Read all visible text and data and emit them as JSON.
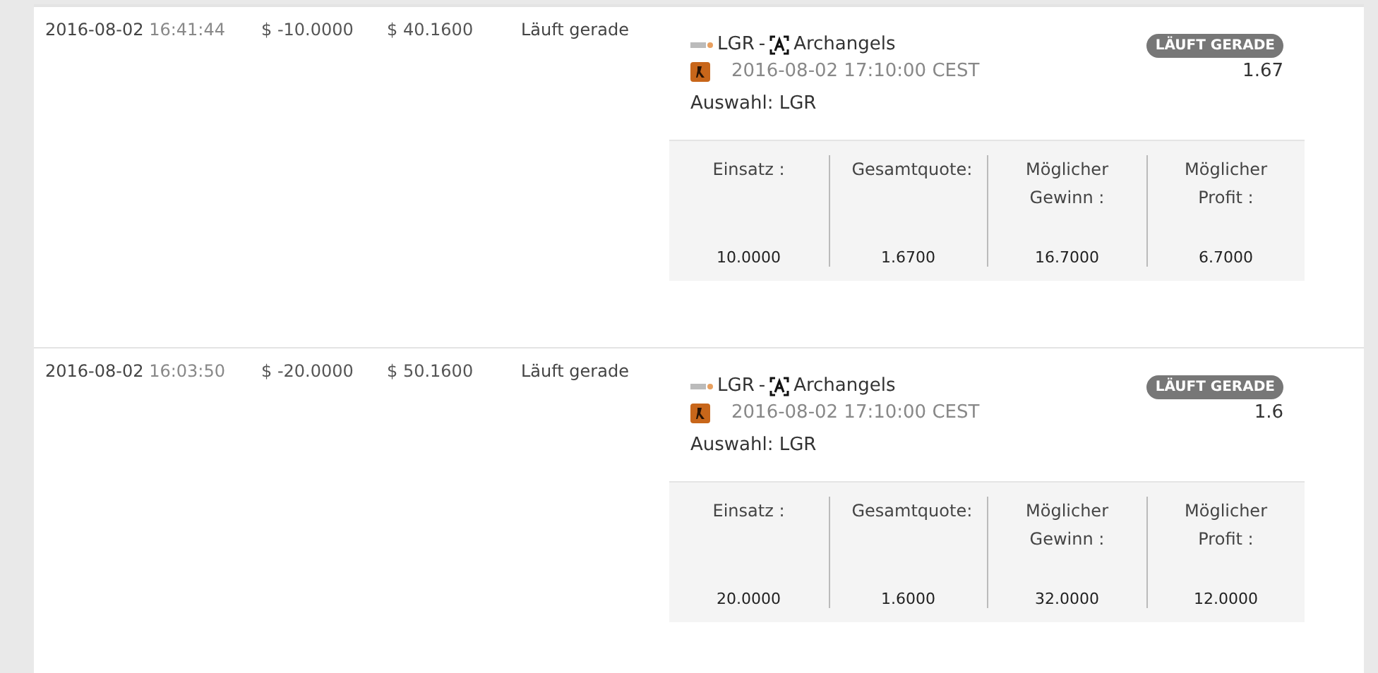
{
  "bets": [
    {
      "date": "2016-08-02",
      "time": "16:41:44",
      "amount": "$ -10.0000",
      "balance": "$ 40.1600",
      "status": "Läuft gerade",
      "team_a": "LGR",
      "separator": "-",
      "team_b": "Archangels",
      "match_time": "2016-08-02 17:10:00 CEST",
      "selection": "Auswahl: LGR",
      "badge": "LÄUFT GERADE",
      "odds": "1.67",
      "stats": [
        {
          "label": "Einsatz :",
          "value": "10.0000"
        },
        {
          "label": "Gesamtquote:",
          "value": "1.6700"
        },
        {
          "label": "Möglicher Gewinn :",
          "value": "16.7000"
        },
        {
          "label": "Möglicher Profit :",
          "value": "6.7000"
        }
      ]
    },
    {
      "date": "2016-08-02",
      "time": "16:03:50",
      "amount": "$ -20.0000",
      "balance": "$ 50.1600",
      "status": "Läuft gerade",
      "team_a": "LGR",
      "separator": "-",
      "team_b": "Archangels",
      "match_time": "2016-08-02 17:10:00 CEST",
      "selection": "Auswahl: LGR",
      "badge": "LÄUFT GERADE",
      "odds": "1.6",
      "stats": [
        {
          "label": "Einsatz :",
          "value": "20.0000"
        },
        {
          "label": "Gesamtquote:",
          "value": "1.6000"
        },
        {
          "label": "Möglicher Gewinn :",
          "value": "32.0000"
        },
        {
          "label": "Möglicher Profit :",
          "value": "12.0000"
        }
      ]
    }
  ]
}
